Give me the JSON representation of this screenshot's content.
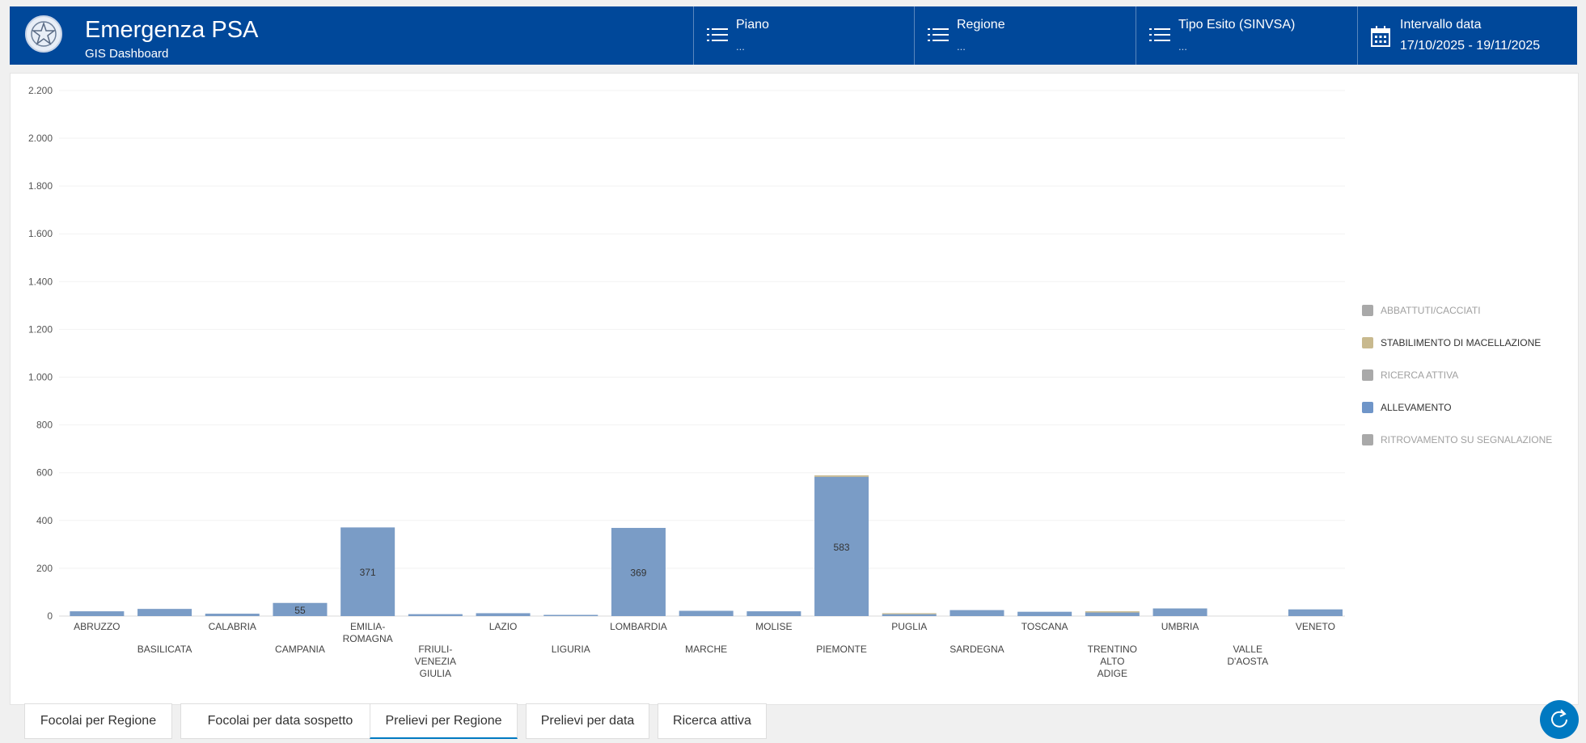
{
  "header": {
    "title": "Emergenza PSA",
    "subtitle": "GIS Dashboard"
  },
  "filters": [
    {
      "label": "Piano",
      "value": "...",
      "icon": "list-icon"
    },
    {
      "label": "Regione",
      "value": "...",
      "icon": "list-icon"
    },
    {
      "label": "Tipo Esito (SINVSA)",
      "value": "...",
      "icon": "list-icon"
    },
    {
      "label": "Intervallo data",
      "value": "17/10/2025 - 19/11/2025",
      "icon": "calendar-icon"
    }
  ],
  "chart_data": {
    "type": "bar",
    "stacked": true,
    "ylim": [
      0,
      2200
    ],
    "yticks": [
      "0",
      "200",
      "400",
      "600",
      "800",
      "1.000",
      "1.200",
      "1.400",
      "1.600",
      "1.800",
      "2.000",
      "2.200"
    ],
    "grid": true,
    "legend_position": "right",
    "categories": [
      "ABRUZZO",
      "BASILICATA",
      "CALABRIA",
      "CAMPANIA",
      "EMILIA-ROMAGNA",
      "FRIULI-VENEZIA GIULIA",
      "LAZIO",
      "LIGURIA",
      "LOMBARDIA",
      "MARCHE",
      "MOLISE",
      "PIEMONTE",
      "PUGLIA",
      "SARDEGNA",
      "TOSCANA",
      "TRENTINO ALTO ADIGE",
      "UMBRIA",
      "VALLE D'AOSTA",
      "VENETO"
    ],
    "category_labels": [
      [
        "ABRUZZO"
      ],
      [
        "BASILICATA"
      ],
      [
        "CALABRIA"
      ],
      [
        "CAMPANIA"
      ],
      [
        "EMILIA-",
        "ROMAGNA"
      ],
      [
        "FRIULI-",
        "VENEZIA",
        "GIULIA"
      ],
      [
        "LAZIO"
      ],
      [
        "LIGURIA"
      ],
      [
        "LOMBARDIA"
      ],
      [
        "MARCHE"
      ],
      [
        "MOLISE"
      ],
      [
        "PIEMONTE"
      ],
      [
        "PUGLIA"
      ],
      [
        "SARDEGNA"
      ],
      [
        "TOSCANA"
      ],
      [
        "TRENTINO",
        "ALTO",
        "ADIGE"
      ],
      [
        "UMBRIA"
      ],
      [
        "VALLE",
        "D'AOSTA"
      ],
      [
        "VENETO"
      ]
    ],
    "series": [
      {
        "name": "ALLEVAMENTO",
        "color": "#7a9cc6",
        "values": [
          20,
          30,
          10,
          55,
          371,
          8,
          12,
          5,
          369,
          22,
          20,
          583,
          8,
          25,
          18,
          15,
          32,
          0,
          28
        ],
        "labels": [
          null,
          null,
          null,
          "55",
          "371",
          null,
          null,
          null,
          "369",
          null,
          null,
          "583",
          null,
          null,
          null,
          null,
          null,
          null,
          null
        ]
      },
      {
        "name": "STABILIMENTO DI MACELLAZIONE",
        "color": "#c8b98e",
        "values": [
          0,
          0,
          0,
          0,
          0,
          0,
          0,
          0,
          0,
          0,
          0,
          6,
          4,
          0,
          0,
          5,
          0,
          0,
          0
        ]
      },
      {
        "name": "ABBATTUTI/CACCIATI",
        "color": "#a9a9a9",
        "values": [
          0,
          0,
          0,
          0,
          0,
          0,
          0,
          0,
          0,
          0,
          0,
          0,
          0,
          0,
          0,
          0,
          0,
          0,
          0
        ]
      },
      {
        "name": "RICERCA ATTIVA",
        "color": "#a9a9a9",
        "values": [
          0,
          0,
          0,
          0,
          0,
          0,
          0,
          0,
          0,
          0,
          0,
          0,
          0,
          0,
          0,
          0,
          0,
          0,
          0
        ]
      },
      {
        "name": "RITROVAMENTO SU SEGNALAZIONE",
        "color": "#a9a9a9",
        "values": [
          0,
          0,
          0,
          0,
          0,
          0,
          0,
          0,
          0,
          0,
          0,
          0,
          0,
          0,
          0,
          0,
          0,
          0,
          0
        ]
      }
    ],
    "legend": [
      {
        "name": "ABBATTUTI/CACCIATI",
        "color": "#a9a9a9",
        "muted": true
      },
      {
        "name": "STABILIMENTO DI MACELLAZIONE",
        "color": "#c8b98e",
        "muted": false
      },
      {
        "name": "RICERCA ATTIVA",
        "color": "#a9a9a9",
        "muted": true
      },
      {
        "name": "ALLEVAMENTO",
        "color": "#6f95c8",
        "muted": false
      },
      {
        "name": "RITROVAMENTO SU SEGNALAZIONE",
        "color": "#a9a9a9",
        "muted": true
      }
    ]
  },
  "tabs": [
    {
      "label": "Focolai per Regione",
      "active": false
    },
    {
      "label": "Focolai per data sospetto",
      "active": false
    },
    {
      "label": "Prelievi per Regione",
      "active": true
    },
    {
      "label": "Prelievi per data",
      "active": false
    },
    {
      "label": "Ricerca attiva",
      "active": false
    }
  ],
  "icons": {
    "logo": "emblem-icon",
    "refresh": "refresh-icon"
  },
  "colors": {
    "header_bg": "#00489a",
    "accent": "#0079c1"
  }
}
